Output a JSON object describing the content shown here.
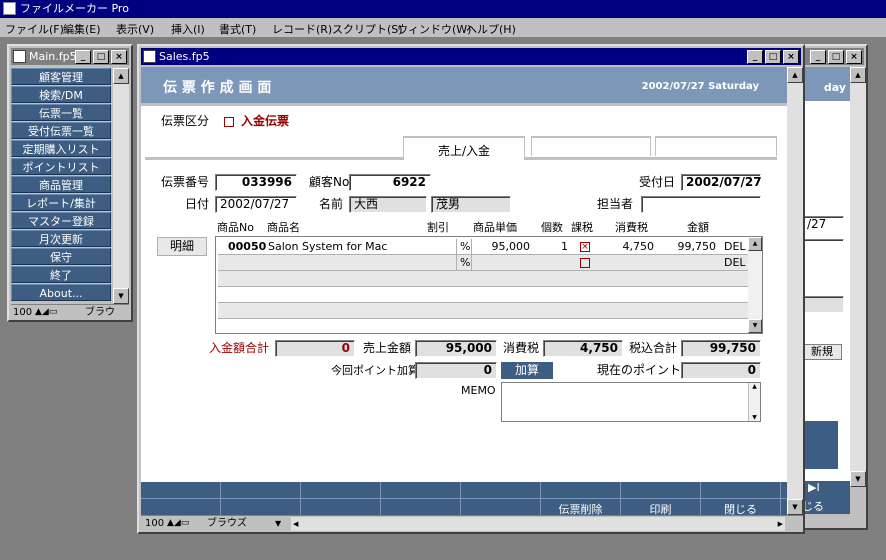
{
  "app": {
    "title": "ファイルメーカー Pro"
  },
  "menu": [
    "ファイル(F)",
    "編集(E)",
    "表示(V)",
    "挿入(I)",
    "書式(T)",
    "レコード(R)",
    "スクリプト(S)",
    "ウィンドウ(W)",
    "ヘルプ(H)"
  ],
  "main_window": {
    "title": "Main.fp5",
    "nav": [
      "顧客管理",
      "検索/DM",
      "伝票一覧",
      "受付伝票一覧",
      "定期購入リスト",
      "ポイントリスト",
      "商品管理",
      "レポート/集計",
      "マスター登録",
      "月次更新",
      "保守",
      "終了",
      "About..."
    ],
    "status_zoom": "100",
    "status_mode": "ブラウ"
  },
  "bg_window": {
    "header_text": "day",
    "date": "/27",
    "new_button": "新規",
    "next_icon": "▶I",
    "close_label": "じる"
  },
  "sales_window": {
    "title": "Sales.fp5",
    "header_title": "伝 票 作 成 画 面",
    "header_date": "2002/07/27 Saturday",
    "slip_type_label": "伝票区分",
    "slip_type_value": "入金伝票",
    "tabs": [
      "売上/入金",
      "",
      ""
    ],
    "slip_no_label": "伝票番号",
    "slip_no": "033996",
    "customer_no_label": "顧客No",
    "customer_no": "6922",
    "receipt_date_label": "受付日",
    "receipt_date": "2002/07/27",
    "date_label": "日付",
    "date": "2002/07/27",
    "name_label": "名前",
    "last_name": "大西",
    "first_name": "茂男",
    "staff_label": "担当者",
    "staff": "",
    "detail_button": "明細",
    "columns": [
      "商品No",
      "商品名",
      "割引",
      "商品単価",
      "個数",
      "課税",
      "消費税",
      "金額"
    ],
    "items": [
      {
        "no": "00050",
        "name": "Salon System for Mac",
        "discount_unit": "%",
        "price": "95,000",
        "qty": "1",
        "taxed": true,
        "tax": "4,750",
        "amount": "99,750",
        "del": "DEL"
      },
      {
        "no": "",
        "name": "",
        "discount_unit": "%",
        "price": "",
        "qty": "",
        "taxed": false,
        "tax": "",
        "amount": "",
        "del": "DEL"
      }
    ],
    "deposit_total_label": "入金額合計",
    "deposit_total": "0",
    "sales_amount_label": "売上金額",
    "sales_amount": "95,000",
    "tax_label": "消費税",
    "tax_total": "4,750",
    "total_with_tax_label": "税込合計",
    "total_with_tax": "99,750",
    "points_added_label": "今回ポイント加算",
    "points_added": "0",
    "add_button": "加算",
    "current_points_label": "現在のポイント数",
    "current_points": "0",
    "memo_label": "MEMO",
    "memo": "",
    "footer_buttons": [
      "",
      "",
      "",
      "",
      "",
      "伝票削除",
      "印刷",
      "閉じる"
    ],
    "status_zoom": "100",
    "status_mode": "ブラウズ"
  },
  "colors": {
    "header_bg": "#7d97b8",
    "nav_bg": "#3d5e82",
    "accent_red": "#990000",
    "title_active": "#000080"
  }
}
